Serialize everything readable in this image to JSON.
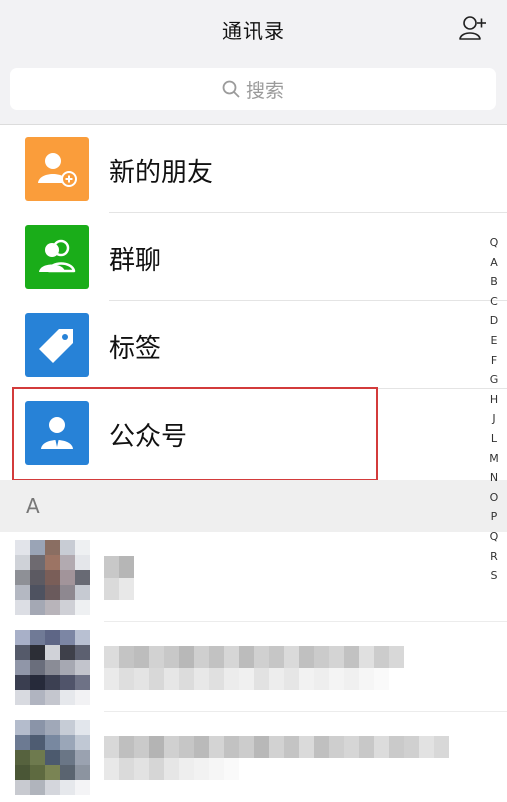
{
  "header": {
    "title": "通讯录",
    "add_icon": "add-contact-icon"
  },
  "search": {
    "placeholder": "搜索",
    "icon": "search-icon"
  },
  "menu": [
    {
      "label": "新的朋友",
      "color": "#fa9d3b",
      "icon": "new-friend-icon"
    },
    {
      "label": "群聊",
      "color": "#1aad19",
      "icon": "group-chat-icon"
    },
    {
      "label": "标签",
      "color": "#2782d7",
      "icon": "tag-icon"
    },
    {
      "label": "公众号",
      "color": "#2782d7",
      "icon": "official-account-icon"
    }
  ],
  "section": {
    "letter": "A"
  },
  "index_letters": [
    "Q",
    "A",
    "B",
    "C",
    "D",
    "E",
    "F",
    "G",
    "H",
    "J",
    "L",
    "M",
    "N",
    "O",
    "P",
    "Q",
    "R",
    "S"
  ],
  "colors": {
    "header_bg": "#f2f2f4",
    "highlight": "#d33b3b",
    "section_bg": "#efefef"
  }
}
